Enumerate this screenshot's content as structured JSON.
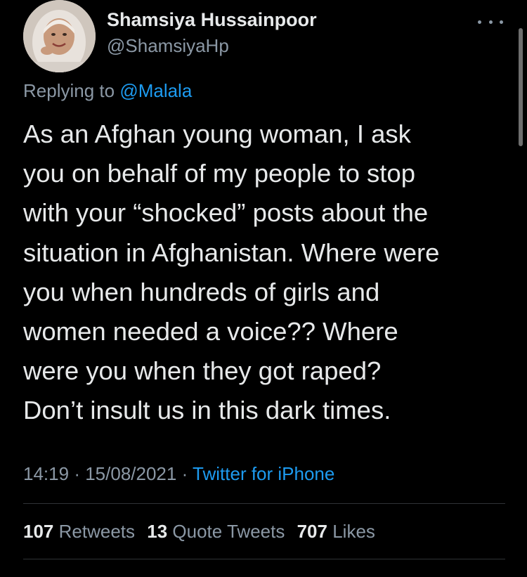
{
  "author": {
    "display_name": "Shamsiya Hussainpoor",
    "handle": "@ShamsiyaHp",
    "avatar_icon": "profile-photo"
  },
  "more_icon": "ellipsis-icon",
  "reply": {
    "prefix": "Replying to",
    "mention": "@Malala"
  },
  "tweet": {
    "lines": [
      "As an Afghan young woman, I ask",
      "you on behalf of my people to stop",
      "with your “shocked” posts about the",
      "situation in Afghanistan. Where were",
      "you when hundreds of girls and",
      "women needed a voice?? Where",
      "were you when they got raped?",
      "Don’t insult us in this dark times."
    ]
  },
  "meta": {
    "time": "14:19",
    "date": "15/08/2021",
    "separator": "·",
    "source": "Twitter for iPhone"
  },
  "stats": {
    "retweets_count": "107",
    "retweets_label": "Retweets",
    "quotes_count": "13",
    "quotes_label": "Quote Tweets",
    "likes_count": "707",
    "likes_label": "Likes"
  },
  "colors": {
    "background": "#000000",
    "text": "#e7e9ea",
    "secondary": "#8b98a5",
    "link": "#1d9bf0",
    "divider": "#2f3336"
  }
}
